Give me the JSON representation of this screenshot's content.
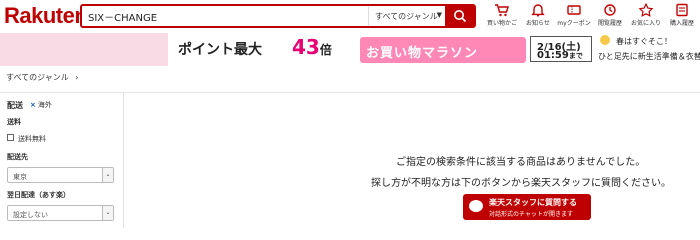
{
  "header": {
    "logo": "Rakuten",
    "search": {
      "value": "SIX－CHANGE",
      "genre": "すべてのジャンル"
    },
    "nav": [
      {
        "label": "買い物かご",
        "icon": "cart-icon"
      },
      {
        "label": "お知らせ",
        "icon": "bell-icon"
      },
      {
        "label": "myクーポン",
        "icon": "coupon-icon"
      },
      {
        "label": "閲覧履歴",
        "icon": "history-icon"
      },
      {
        "label": "お気に入り",
        "icon": "star-icon"
      },
      {
        "label": "購入履歴",
        "icon": "purchase-history-icon"
      }
    ]
  },
  "banner": {
    "title": "ポイント最大",
    "multiplier": "43",
    "multiplier_suffix": "倍",
    "marathon": "お買い物マラソン",
    "date": "2/16(土)",
    "time": "01:59",
    "time_suffix": "まで",
    "copy_line1": "春はすぐそこ！",
    "copy_line2": "ひと足先に新生活準備＆衣替え"
  },
  "breadcrumb": {
    "label": "すべてのジャンル",
    "separator": "›"
  },
  "sidebar": {
    "delivery_heading": "配送",
    "overseas_x": "×",
    "overseas_label": "海外",
    "shipping_heading": "送料",
    "free_shipping_label": "送料無料",
    "destination_heading": "配送先",
    "destination_value": "東京",
    "next_day_heading": "翌日配達（あす楽）",
    "next_day_value": "設定しない",
    "select_arrow": "⌄"
  },
  "main": {
    "no_results": "ご指定の検索条件に該当する商品はありませんでした。",
    "help_text": "探し方が不明な方は下のボタンから楽天スタッフに質問ください。",
    "ask_button_label": "楽天スタッフに質問する",
    "ask_button_sub": "対話形式のチャットが開きます"
  },
  "colors": {
    "brand": "#bf0000",
    "banner_bg": "#f9dbe6",
    "marathon": "#ff88b7",
    "multiplier": "#e60073"
  }
}
